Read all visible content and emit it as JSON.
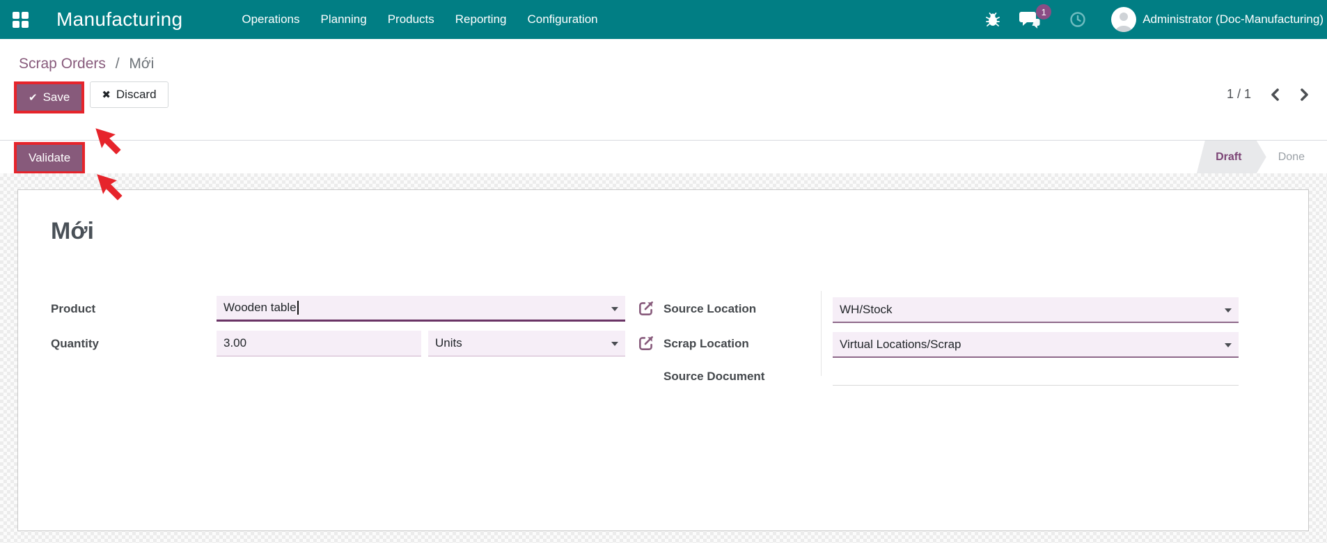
{
  "header": {
    "app_name": "Manufacturing",
    "menus": [
      "Operations",
      "Planning",
      "Products",
      "Reporting",
      "Configuration"
    ],
    "message_count": "1",
    "user_name": "Administrator (Doc-Manufacturing)"
  },
  "breadcrumb": {
    "parent": "Scrap Orders",
    "separator": "/",
    "current": "Mới"
  },
  "actions": {
    "save": "Save",
    "discard": "Discard",
    "validate": "Validate"
  },
  "icons": {
    "save_check": "✔",
    "discard_x": "✖"
  },
  "pager": {
    "value": "1 / 1"
  },
  "statusbar": {
    "stages": [
      "Draft",
      "Done"
    ],
    "active": "Draft"
  },
  "form": {
    "title": "Mới",
    "product": {
      "label": "Product",
      "value": "Wooden table"
    },
    "quantity": {
      "label": "Quantity",
      "value": "3.00",
      "uom": "Units"
    },
    "source_location": {
      "label": "Source Location",
      "value": "WH/Stock"
    },
    "scrap_location": {
      "label": "Scrap Location",
      "value": "Virtual Locations/Scrap"
    },
    "source_document": {
      "label": "Source Document",
      "value": ""
    }
  },
  "colors": {
    "header_bg": "#017e84",
    "accent_purple": "#875a7b",
    "highlight_red": "#e6242b",
    "field_bg": "#f6eef7",
    "badge_bg": "#8a4d85"
  }
}
